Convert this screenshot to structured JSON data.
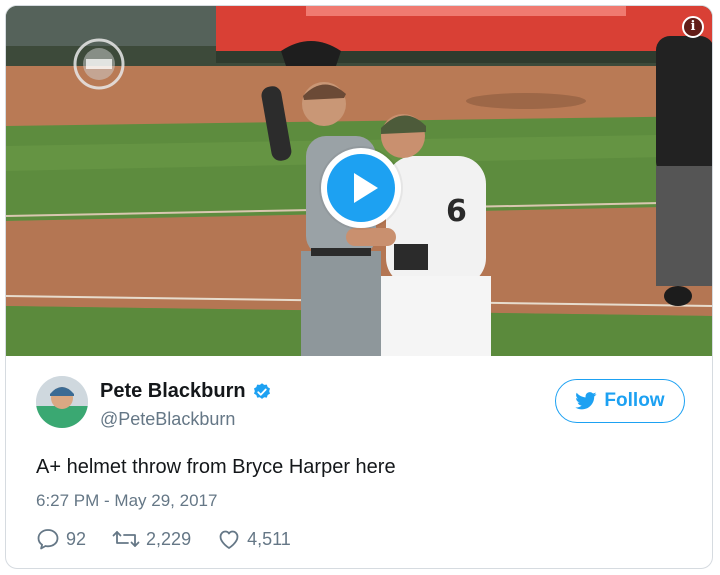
{
  "media": {
    "info_icon": "info-icon",
    "play_icon": "play-icon",
    "watermark_icon": "espn-baseball-logo"
  },
  "tweet": {
    "display_name": "Pete Blackburn",
    "handle": "@PeteBlackburn",
    "verified": true,
    "follow_label": "Follow",
    "text": "A+ helmet throw from Bryce Harper here",
    "timestamp": "6:27 PM - May 29, 2017",
    "stats": {
      "replies": "92",
      "retweets": "2,229",
      "likes": "4,511"
    }
  },
  "colors": {
    "accent": "#1da1f2",
    "text_primary": "#14171a",
    "text_secondary": "#657786",
    "border": "#d6dbe0"
  }
}
